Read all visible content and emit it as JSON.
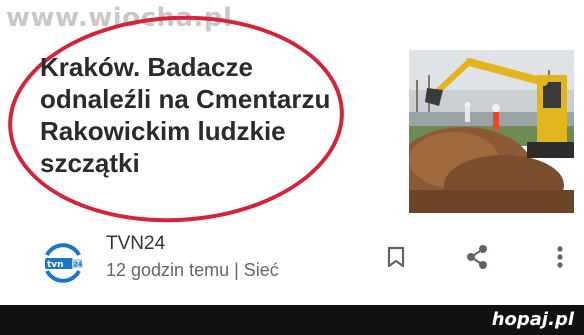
{
  "watermark": {
    "text": "www.wiocha.pl"
  },
  "article": {
    "headline_lines": [
      "Kraków. Badacze",
      "odnaleźli na Cmentarzu",
      "Rakowickim ludzkie",
      "szczątki"
    ],
    "thumbnail": {
      "subject": "excavator-dig-site"
    }
  },
  "source": {
    "logo_text": "tvn",
    "logo_badge": "24",
    "name": "TVN24",
    "time_info": "12 godzin temu | Sieć"
  },
  "actions": {
    "bookmark_icon": "bookmark-icon",
    "share_icon": "share-icon",
    "more_icon": "more-vertical-icon"
  },
  "footer": {
    "brand": "hopaj.pl"
  },
  "colors": {
    "highlight_ring": "#d4243a",
    "logo_blue": "#1b77c5",
    "icon_gray": "#5f6368",
    "footer_bg": "#111111"
  }
}
